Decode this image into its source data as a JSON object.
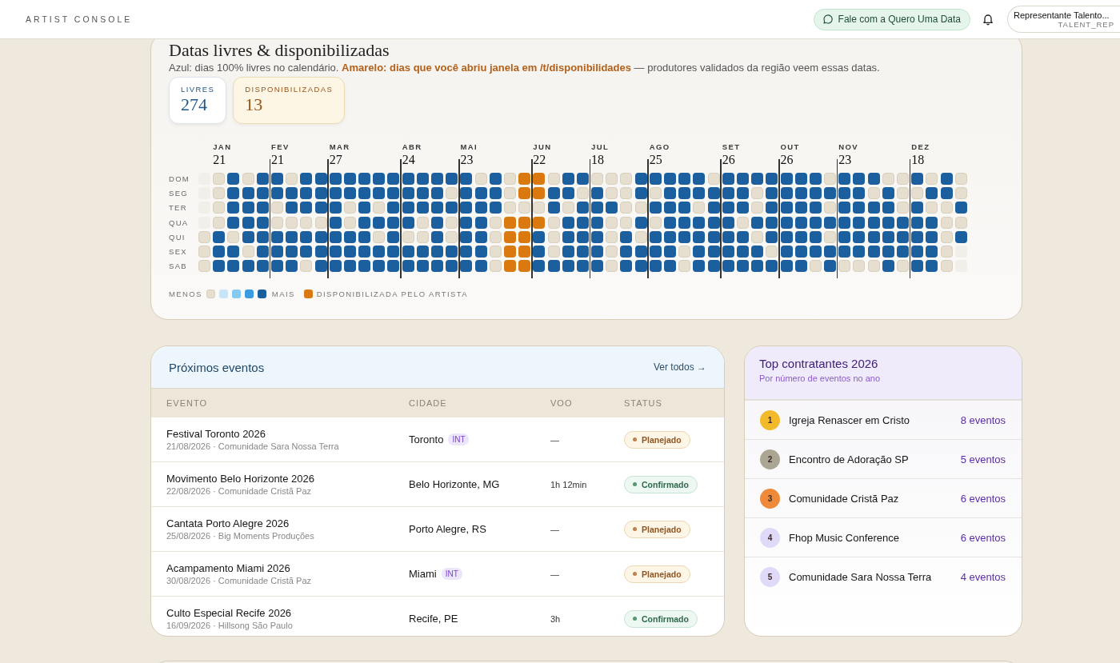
{
  "header": {
    "brand": "ARTIST CONSOLE",
    "contact_button": "Fale com a Quero Uma Data",
    "user": {
      "name": "Representante Talento...",
      "role": "TALENT_REP"
    }
  },
  "availability": {
    "title": "Datas livres & disponibilizadas",
    "description": "Azul: dias 100% livres no calendário. **Amarelo: dias que você abriu janela em /t/disponibilidades** — produtores validados da região veem essas datas.",
    "stats": [
      {
        "kind": "free",
        "label": "LIVRES",
        "value": "274"
      },
      {
        "kind": "released",
        "label": "DISPONIBILIZADAS",
        "value": "13"
      }
    ],
    "heatmap": {
      "weekdays": [
        "DOM",
        "SEG",
        "TER",
        "QUA",
        "QUI",
        "SEX",
        "SAB"
      ],
      "months": [
        {
          "label": "JAN",
          "day": "21",
          "rows": [
            [
              {
                "kind": "outside"
              },
              {
                "kind": "none"
              },
              {
                "kind": "full"
              },
              {
                "kind": "none"
              },
              {
                "kind": "full"
              }
            ],
            [
              {
                "kind": "outside"
              },
              {
                "kind": "none"
              },
              {
                "kind": "full"
              },
              {
                "kind": "full"
              },
              {
                "kind": "full"
              }
            ],
            [
              {
                "kind": "outside"
              },
              {
                "kind": "none"
              },
              {
                "kind": "full"
              },
              {
                "kind": "full"
              },
              {
                "kind": "full"
              }
            ],
            [
              {
                "kind": "outside"
              },
              {
                "kind": "none"
              },
              {
                "kind": "full"
              },
              {
                "kind": "full"
              },
              {
                "kind": "full"
              }
            ],
            [
              {
                "kind": "none"
              },
              {
                "kind": "full"
              },
              {
                "kind": "none"
              },
              {
                "kind": "full"
              },
              {
                "kind": "full"
              }
            ],
            [
              {
                "kind": "none"
              },
              {
                "kind": "full"
              },
              {
                "kind": "full"
              },
              {
                "kind": "none"
              },
              {
                "kind": "full"
              }
            ],
            [
              {
                "kind": "none"
              },
              {
                "kind": "full"
              },
              {
                "kind": "full"
              },
              {
                "kind": "full"
              },
              {
                "kind": "full"
              }
            ]
          ]
        },
        {
          "label": "FEV",
          "day": "21",
          "rows": [
            [
              {
                "kind": "full"
              },
              {
                "kind": "none"
              },
              {
                "kind": "full"
              },
              {
                "kind": "full"
              }
            ],
            [
              {
                "kind": "full"
              },
              {
                "kind": "full"
              },
              {
                "kind": "full"
              },
              {
                "kind": "full"
              }
            ],
            [
              {
                "kind": "none"
              },
              {
                "kind": "full"
              },
              {
                "kind": "full"
              },
              {
                "kind": "full"
              }
            ],
            [
              {
                "kind": "none"
              },
              {
                "kind": "none"
              },
              {
                "kind": "none"
              },
              {
                "kind": "none"
              }
            ],
            [
              {
                "kind": "full"
              },
              {
                "kind": "full"
              },
              {
                "kind": "full"
              },
              {
                "kind": "full"
              }
            ],
            [
              {
                "kind": "full"
              },
              {
                "kind": "full"
              },
              {
                "kind": "full"
              },
              {
                "kind": "full"
              }
            ],
            [
              {
                "kind": "full"
              },
              {
                "kind": "full"
              },
              {
                "kind": "none"
              },
              {
                "kind": "full"
              }
            ]
          ]
        },
        {
          "label": "MAR",
          "day": "27",
          "rows": [
            [
              {
                "kind": "full"
              },
              {
                "kind": "full"
              },
              {
                "kind": "full"
              },
              {
                "kind": "full"
              },
              {
                "kind": "full"
              }
            ],
            [
              {
                "kind": "full"
              },
              {
                "kind": "full"
              },
              {
                "kind": "full"
              },
              {
                "kind": "full"
              },
              {
                "kind": "full"
              }
            ],
            [
              {
                "kind": "full"
              },
              {
                "kind": "none"
              },
              {
                "kind": "full"
              },
              {
                "kind": "none"
              },
              {
                "kind": "full"
              }
            ],
            [
              {
                "kind": "full"
              },
              {
                "kind": "none"
              },
              {
                "kind": "full"
              },
              {
                "kind": "full"
              },
              {
                "kind": "full"
              }
            ],
            [
              {
                "kind": "full"
              },
              {
                "kind": "full"
              },
              {
                "kind": "full"
              },
              {
                "kind": "none"
              },
              {
                "kind": "full"
              }
            ],
            [
              {
                "kind": "full"
              },
              {
                "kind": "full"
              },
              {
                "kind": "full"
              },
              {
                "kind": "full"
              },
              {
                "kind": "full"
              }
            ],
            [
              {
                "kind": "full"
              },
              {
                "kind": "full"
              },
              {
                "kind": "full"
              },
              {
                "kind": "full"
              },
              {
                "kind": "full"
              }
            ]
          ]
        },
        {
          "label": "ABR",
          "day": "24",
          "rows": [
            [
              {
                "kind": "full"
              },
              {
                "kind": "full"
              },
              {
                "kind": "full"
              },
              {
                "kind": "full"
              }
            ],
            [
              {
                "kind": "full"
              },
              {
                "kind": "full"
              },
              {
                "kind": "full"
              },
              {
                "kind": "none"
              }
            ],
            [
              {
                "kind": "full"
              },
              {
                "kind": "full"
              },
              {
                "kind": "full"
              },
              {
                "kind": "full"
              }
            ],
            [
              {
                "kind": "full"
              },
              {
                "kind": "none"
              },
              {
                "kind": "full"
              },
              {
                "kind": "none"
              }
            ],
            [
              {
                "kind": "none"
              },
              {
                "kind": "none"
              },
              {
                "kind": "full"
              },
              {
                "kind": "none"
              }
            ],
            [
              {
                "kind": "full"
              },
              {
                "kind": "full"
              },
              {
                "kind": "full"
              },
              {
                "kind": "full"
              }
            ],
            [
              {
                "kind": "full"
              },
              {
                "kind": "full"
              },
              {
                "kind": "full"
              },
              {
                "kind": "full"
              }
            ]
          ]
        },
        {
          "label": "MAI",
          "day": "23",
          "rows": [
            [
              {
                "kind": "full"
              },
              {
                "kind": "none"
              },
              {
                "kind": "full"
              },
              {
                "kind": "none"
              },
              {
                "kind": "released"
              }
            ],
            [
              {
                "kind": "full"
              },
              {
                "kind": "full"
              },
              {
                "kind": "full"
              },
              {
                "kind": "none"
              },
              {
                "kind": "released"
              }
            ],
            [
              {
                "kind": "full"
              },
              {
                "kind": "full"
              },
              {
                "kind": "full"
              },
              {
                "kind": "none"
              },
              {
                "kind": "none"
              }
            ],
            [
              {
                "kind": "full"
              },
              {
                "kind": "full"
              },
              {
                "kind": "none"
              },
              {
                "kind": "released"
              },
              {
                "kind": "released"
              }
            ],
            [
              {
                "kind": "full"
              },
              {
                "kind": "full"
              },
              {
                "kind": "none"
              },
              {
                "kind": "released"
              },
              {
                "kind": "released"
              }
            ],
            [
              {
                "kind": "full"
              },
              {
                "kind": "full"
              },
              {
                "kind": "none"
              },
              {
                "kind": "released"
              },
              {
                "kind": "released"
              }
            ],
            [
              {
                "kind": "full"
              },
              {
                "kind": "full"
              },
              {
                "kind": "none"
              },
              {
                "kind": "released"
              },
              {
                "kind": "released"
              }
            ]
          ]
        },
        {
          "label": "JUN",
          "day": "22",
          "rows": [
            [
              {
                "kind": "released"
              },
              {
                "kind": "none"
              },
              {
                "kind": "full"
              },
              {
                "kind": "full"
              }
            ],
            [
              {
                "kind": "released"
              },
              {
                "kind": "full"
              },
              {
                "kind": "full"
              },
              {
                "kind": "none"
              }
            ],
            [
              {
                "kind": "none"
              },
              {
                "kind": "full"
              },
              {
                "kind": "none"
              },
              {
                "kind": "full"
              }
            ],
            [
              {
                "kind": "released"
              },
              {
                "kind": "none"
              },
              {
                "kind": "full"
              },
              {
                "kind": "full"
              }
            ],
            [
              {
                "kind": "full"
              },
              {
                "kind": "none"
              },
              {
                "kind": "full"
              },
              {
                "kind": "full"
              }
            ],
            [
              {
                "kind": "full"
              },
              {
                "kind": "none"
              },
              {
                "kind": "full"
              },
              {
                "kind": "full"
              }
            ],
            [
              {
                "kind": "full"
              },
              {
                "kind": "full"
              },
              {
                "kind": "full"
              },
              {
                "kind": "full"
              }
            ]
          ]
        },
        {
          "label": "JUL",
          "day": "18",
          "rows": [
            [
              {
                "kind": "none"
              },
              {
                "kind": "none"
              },
              {
                "kind": "none"
              },
              {
                "kind": "full"
              }
            ],
            [
              {
                "kind": "full"
              },
              {
                "kind": "none"
              },
              {
                "kind": "none"
              },
              {
                "kind": "full"
              }
            ],
            [
              {
                "kind": "full"
              },
              {
                "kind": "full"
              },
              {
                "kind": "none"
              },
              {
                "kind": "none"
              }
            ],
            [
              {
                "kind": "full"
              },
              {
                "kind": "none"
              },
              {
                "kind": "none"
              },
              {
                "kind": "full"
              }
            ],
            [
              {
                "kind": "full"
              },
              {
                "kind": "none"
              },
              {
                "kind": "full"
              },
              {
                "kind": "none"
              }
            ],
            [
              {
                "kind": "full"
              },
              {
                "kind": "none"
              },
              {
                "kind": "full"
              },
              {
                "kind": "full"
              }
            ],
            [
              {
                "kind": "full"
              },
              {
                "kind": "none"
              },
              {
                "kind": "full"
              },
              {
                "kind": "full"
              }
            ]
          ]
        },
        {
          "label": "AGO",
          "day": "25",
          "rows": [
            [
              {
                "kind": "full"
              },
              {
                "kind": "full"
              },
              {
                "kind": "full"
              },
              {
                "kind": "full"
              },
              {
                "kind": "none"
              }
            ],
            [
              {
                "kind": "none"
              },
              {
                "kind": "full"
              },
              {
                "kind": "full"
              },
              {
                "kind": "full"
              },
              {
                "kind": "full"
              }
            ],
            [
              {
                "kind": "full"
              },
              {
                "kind": "full"
              },
              {
                "kind": "full"
              },
              {
                "kind": "none"
              },
              {
                "kind": "full"
              }
            ],
            [
              {
                "kind": "none"
              },
              {
                "kind": "full"
              },
              {
                "kind": "full"
              },
              {
                "kind": "full"
              },
              {
                "kind": "full"
              }
            ],
            [
              {
                "kind": "full"
              },
              {
                "kind": "full"
              },
              {
                "kind": "full"
              },
              {
                "kind": "full"
              },
              {
                "kind": "full"
              }
            ],
            [
              {
                "kind": "full"
              },
              {
                "kind": "full"
              },
              {
                "kind": "none"
              },
              {
                "kind": "full"
              },
              {
                "kind": "full"
              }
            ],
            [
              {
                "kind": "full"
              },
              {
                "kind": "full"
              },
              {
                "kind": "none"
              },
              {
                "kind": "full"
              },
              {
                "kind": "full"
              }
            ]
          ]
        },
        {
          "label": "SET",
          "day": "26",
          "rows": [
            [
              {
                "kind": "full"
              },
              {
                "kind": "full"
              },
              {
                "kind": "full"
              },
              {
                "kind": "full"
              }
            ],
            [
              {
                "kind": "full"
              },
              {
                "kind": "full"
              },
              {
                "kind": "none"
              },
              {
                "kind": "full"
              }
            ],
            [
              {
                "kind": "full"
              },
              {
                "kind": "full"
              },
              {
                "kind": "none"
              },
              {
                "kind": "full"
              }
            ],
            [
              {
                "kind": "full"
              },
              {
                "kind": "none"
              },
              {
                "kind": "full"
              },
              {
                "kind": "full"
              }
            ],
            [
              {
                "kind": "full"
              },
              {
                "kind": "full"
              },
              {
                "kind": "none"
              },
              {
                "kind": "full"
              }
            ],
            [
              {
                "kind": "full"
              },
              {
                "kind": "full"
              },
              {
                "kind": "full"
              },
              {
                "kind": "none"
              }
            ],
            [
              {
                "kind": "full"
              },
              {
                "kind": "full"
              },
              {
                "kind": "full"
              },
              {
                "kind": "full"
              }
            ]
          ]
        },
        {
          "label": "OUT",
          "day": "26",
          "rows": [
            [
              {
                "kind": "full"
              },
              {
                "kind": "full"
              },
              {
                "kind": "full"
              },
              {
                "kind": "none"
              }
            ],
            [
              {
                "kind": "full"
              },
              {
                "kind": "full"
              },
              {
                "kind": "full"
              },
              {
                "kind": "full"
              }
            ],
            [
              {
                "kind": "full"
              },
              {
                "kind": "full"
              },
              {
                "kind": "full"
              },
              {
                "kind": "none"
              }
            ],
            [
              {
                "kind": "full"
              },
              {
                "kind": "full"
              },
              {
                "kind": "full"
              },
              {
                "kind": "full"
              }
            ],
            [
              {
                "kind": "full"
              },
              {
                "kind": "full"
              },
              {
                "kind": "full"
              },
              {
                "kind": "none"
              }
            ],
            [
              {
                "kind": "full"
              },
              {
                "kind": "full"
              },
              {
                "kind": "full"
              },
              {
                "kind": "full"
              }
            ],
            [
              {
                "kind": "full"
              },
              {
                "kind": "full"
              },
              {
                "kind": "none"
              },
              {
                "kind": "full"
              }
            ]
          ]
        },
        {
          "label": "NOV",
          "day": "23",
          "rows": [
            [
              {
                "kind": "full"
              },
              {
                "kind": "full"
              },
              {
                "kind": "full"
              },
              {
                "kind": "none"
              },
              {
                "kind": "none"
              }
            ],
            [
              {
                "kind": "full"
              },
              {
                "kind": "full"
              },
              {
                "kind": "none"
              },
              {
                "kind": "full"
              },
              {
                "kind": "none"
              }
            ],
            [
              {
                "kind": "full"
              },
              {
                "kind": "full"
              },
              {
                "kind": "full"
              },
              {
                "kind": "full"
              },
              {
                "kind": "none"
              }
            ],
            [
              {
                "kind": "full"
              },
              {
                "kind": "full"
              },
              {
                "kind": "full"
              },
              {
                "kind": "full"
              },
              {
                "kind": "full"
              }
            ],
            [
              {
                "kind": "full"
              },
              {
                "kind": "full"
              },
              {
                "kind": "full"
              },
              {
                "kind": "full"
              },
              {
                "kind": "full"
              }
            ],
            [
              {
                "kind": "full"
              },
              {
                "kind": "full"
              },
              {
                "kind": "full"
              },
              {
                "kind": "full"
              },
              {
                "kind": "full"
              }
            ],
            [
              {
                "kind": "none"
              },
              {
                "kind": "none"
              },
              {
                "kind": "none"
              },
              {
                "kind": "full"
              },
              {
                "kind": "none"
              }
            ]
          ]
        },
        {
          "label": "DEZ",
          "day": "18",
          "rows": [
            [
              {
                "kind": "full"
              },
              {
                "kind": "none"
              },
              {
                "kind": "full"
              },
              {
                "kind": "none"
              }
            ],
            [
              {
                "kind": "none"
              },
              {
                "kind": "full"
              },
              {
                "kind": "full"
              },
              {
                "kind": "none"
              }
            ],
            [
              {
                "kind": "full"
              },
              {
                "kind": "none"
              },
              {
                "kind": "none"
              },
              {
                "kind": "full"
              }
            ],
            [
              {
                "kind": "full"
              },
              {
                "kind": "full"
              },
              {
                "kind": "none"
              },
              {
                "kind": "none"
              }
            ],
            [
              {
                "kind": "full"
              },
              {
                "kind": "full"
              },
              {
                "kind": "none"
              },
              {
                "kind": "full"
              }
            ],
            [
              {
                "kind": "full"
              },
              {
                "kind": "full"
              },
              {
                "kind": "none"
              },
              {
                "kind": "outside"
              }
            ],
            [
              {
                "kind": "full"
              },
              {
                "kind": "full"
              },
              {
                "kind": "none"
              },
              {
                "kind": "outside"
              }
            ]
          ]
        }
      ],
      "legend": {
        "less": "MENOS",
        "more": "MAIS",
        "swatches": [
          {
            "kind": "none"
          },
          {
            "kind": "low"
          },
          {
            "kind": "mid"
          },
          {
            "kind": "high"
          },
          {
            "kind": "full"
          }
        ],
        "artist": {
          "kind": "released",
          "label": "DISPONIBILIZADA PELO ARTISTA"
        }
      }
    }
  },
  "events": {
    "title": "Próximos eventos",
    "link": "Ver todos →",
    "columns": [
      "EVENTO",
      "CIDADE",
      "VOO",
      "STATUS"
    ],
    "rows": [
      {
        "name": "Festival Toronto 2026",
        "details": "21/08/2026 · Comunidade Sara Nossa Terra",
        "city": "Toronto",
        "badge": "INT",
        "flight": "—",
        "status": "Planejado",
        "kind": "planned"
      },
      {
        "name": "Movimento Belo Horizonte 2026",
        "details": "22/08/2026 · Comunidade Cristã Paz",
        "city": "Belo Horizonte, MG",
        "flight": "1h 12min",
        "status": "Confirmado",
        "kind": "confirmed"
      },
      {
        "name": "Cantata Porto Alegre 2026",
        "details": "25/08/2026 · Big Moments Produções",
        "city": "Porto Alegre, RS",
        "flight": "—",
        "status": "Planejado",
        "kind": "planned"
      },
      {
        "name": "Acampamento Miami 2026",
        "details": "30/08/2026 · Comunidade Cristã Paz",
        "city": "Miami",
        "badge": "INT",
        "flight": "—",
        "status": "Planejado",
        "kind": "planned"
      },
      {
        "name": "Culto Especial Recife 2026",
        "details": "16/09/2026 · Hillsong São Paulo",
        "city": "Recife, PE",
        "flight": "3h",
        "status": "Confirmado",
        "kind": "confirmed"
      }
    ]
  },
  "top_clients": {
    "title": "Top contratantes 2026",
    "subtitle": "Por número de eventos no ano",
    "items": [
      {
        "rank": "1",
        "name": "Igreja Renascer em Cristo",
        "count": "8 eventos",
        "color": "#f2b92a"
      },
      {
        "rank": "2",
        "name": "Encontro de Adoração SP",
        "count": "5 eventos",
        "color": "#aba694"
      },
      {
        "rank": "3",
        "name": "Comunidade Cristã Paz",
        "count": "6 eventos",
        "color": "#ee8a3a"
      },
      {
        "rank": "4",
        "name": "Fhop Music Conference",
        "count": "6 eventos",
        "color": "#e0d9f8"
      },
      {
        "rank": "5",
        "name": "Comunidade Sara Nossa Terra",
        "count": "4 eventos",
        "color": "#e0d9f8"
      }
    ]
  }
}
